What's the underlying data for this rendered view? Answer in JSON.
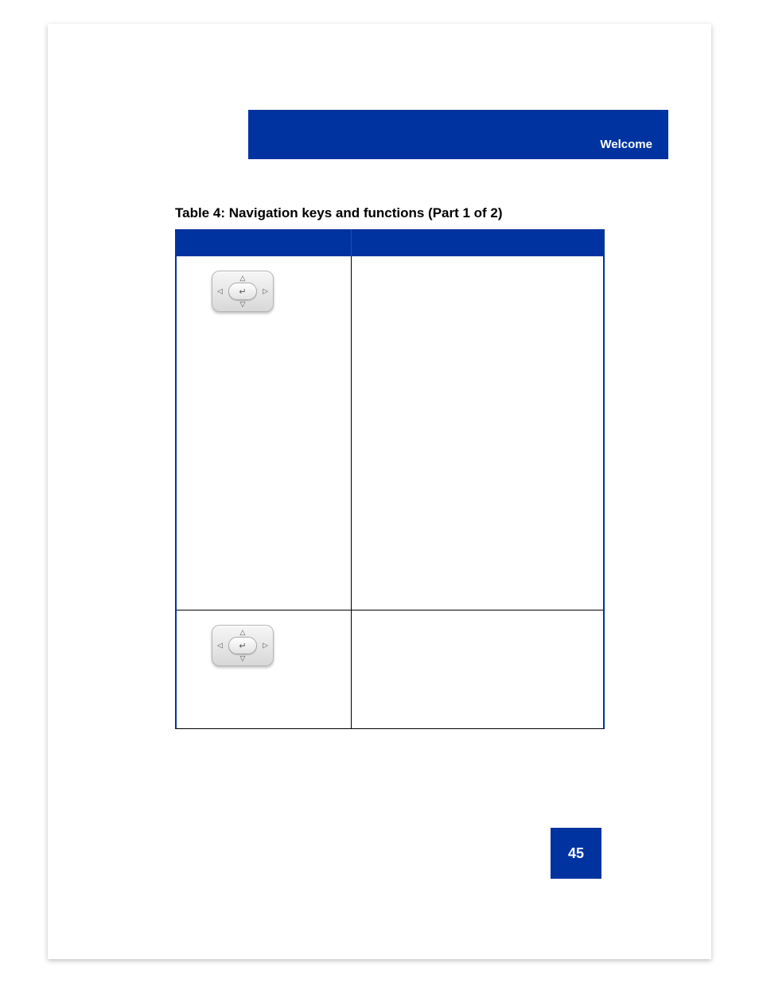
{
  "header": {
    "section_label": "Welcome"
  },
  "table": {
    "caption": "Table 4: Navigation keys and functions (Part 1 of 2)",
    "columns": [
      "",
      ""
    ],
    "rows": [
      {
        "icon": "navigation-pad-icon",
        "description": ""
      },
      {
        "icon": "navigation-pad-icon",
        "description": ""
      }
    ]
  },
  "page_number": "45",
  "colors": {
    "brand_blue": "#0033a0"
  }
}
